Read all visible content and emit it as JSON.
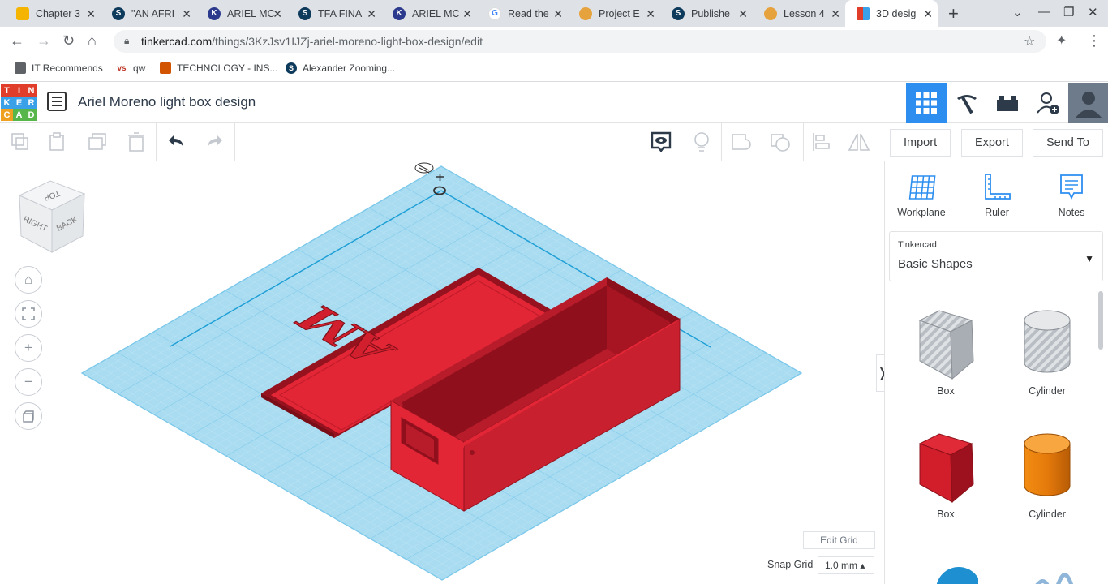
{
  "browser": {
    "tabs": [
      {
        "title": "Chapter 3",
        "favicon": "slides-icon",
        "color": "#f4b400",
        "active": false
      },
      {
        "title": "\"AN AFRI",
        "favicon": "schoology-icon",
        "color": "#0e3a5b",
        "active": false
      },
      {
        "title": "ARIEL MC",
        "favicon": "kami-icon",
        "color": "#2b3a8c",
        "active": false
      },
      {
        "title": "TFA FINA",
        "favicon": "schoology-icon",
        "color": "#0e3a5b",
        "active": false
      },
      {
        "title": "ARIEL MC",
        "favicon": "kami-icon",
        "color": "#2b3a8c",
        "active": false
      },
      {
        "title": "Read the",
        "favicon": "google-icon",
        "color": "#4285f4",
        "active": false
      },
      {
        "title": "Project E",
        "favicon": "avatar-icon",
        "color": "#e6a23c",
        "active": false
      },
      {
        "title": "Publishe",
        "favicon": "schoology-icon",
        "color": "#0e3a5b",
        "active": false
      },
      {
        "title": "Lesson 4",
        "favicon": "avatar-icon",
        "color": "#e6a23c",
        "active": false
      },
      {
        "title": "3D desig",
        "favicon": "tinkercad-icon",
        "color": "#e13d2b",
        "active": true
      }
    ],
    "url_host": "tinkercad.com",
    "url_path": "/things/3KzJsv1IJZj-ariel-moreno-light-box-design/edit",
    "bookmarks": [
      {
        "label": "IT Recommends",
        "icon": "folder-icon"
      },
      {
        "label": "qw",
        "icon": "vs-icon"
      },
      {
        "label": "TECHNOLOGY - INS...",
        "icon": "orange-badge-icon"
      },
      {
        "label": "Alexander Zooming...",
        "icon": "schoology-icon"
      }
    ]
  },
  "app": {
    "logo_letters": [
      "TIN",
      "KER",
      "CAD"
    ],
    "design_title": "Ariel Moreno light box design"
  },
  "toolbar": {
    "import_label": "Import",
    "export_label": "Export",
    "send_to_label": "Send To"
  },
  "canvas": {
    "edit_grid_label": "Edit Grid",
    "snap_grid_label": "Snap Grid",
    "snap_grid_value": "1.0 mm ▴",
    "viewcube": {
      "top": "TOP",
      "right": "RIGHT",
      "back": "BACK"
    },
    "lid_text": "AM",
    "colors": {
      "grid": "#a9dcf1",
      "grid_line": "#7cc8ea",
      "shape_red": "#e32636",
      "shape_dark": "#96121f"
    }
  },
  "panel": {
    "tools": [
      {
        "label": "Workplane",
        "icon": "workplane-icon"
      },
      {
        "label": "Ruler",
        "icon": "ruler-icon"
      },
      {
        "label": "Notes",
        "icon": "notes-icon"
      }
    ],
    "library_owner": "Tinkercad",
    "library_name": "Basic Shapes",
    "shapes": [
      {
        "label": "Box",
        "icon": "box-hole-icon"
      },
      {
        "label": "Cylinder",
        "icon": "cylinder-hole-icon"
      },
      {
        "label": "Box",
        "icon": "box-solid-icon"
      },
      {
        "label": "Cylinder",
        "icon": "cylinder-solid-icon"
      }
    ]
  }
}
